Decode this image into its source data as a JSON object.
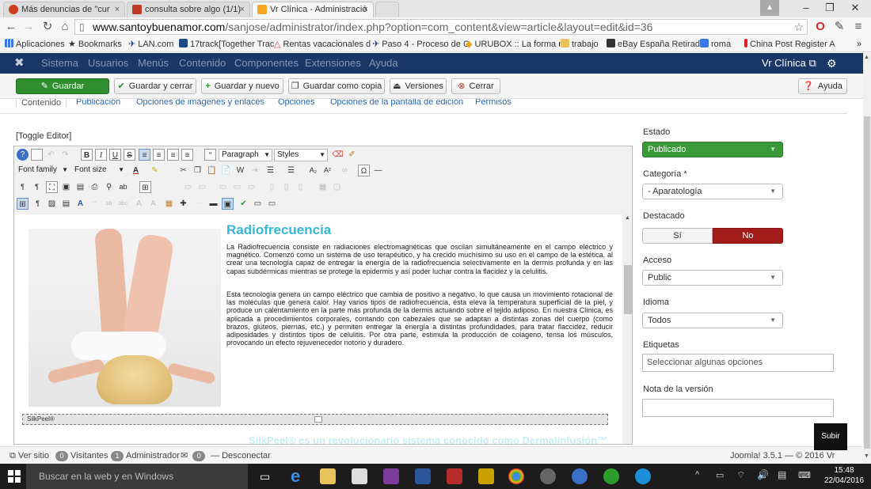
{
  "browser": {
    "tabs": [
      {
        "label": "Más denuncias de \"cur",
        "active": false
      },
      {
        "label": "consulta sobre algo (1/1)",
        "active": false
      },
      {
        "label": "Vr Clínica - Administració",
        "active": true
      }
    ],
    "close_glyph": "×",
    "url_domain": "www.santoybuenamor.com",
    "url_path": "/sanjose/administrator/index.php?option=com_content&view=article&layout=edit&id=36",
    "bookmarks": [
      "Aplicaciones",
      "Bookmarks",
      "LAN.com",
      "17track[Together Trac",
      "Rentas vacacionales d",
      "Paso 4 - Proceso de C",
      "URUBOX :: La forma m",
      "trabajo",
      "eBay España Retirada",
      "roma",
      "China Post Register A"
    ],
    "bookmarks_more": "»"
  },
  "joomla": {
    "menu": [
      "Sistema",
      "Usuarios",
      "Menús",
      "Contenido",
      "Componentes",
      "Extensiones",
      "Ayuda"
    ],
    "site_link": "Vr Clínica",
    "toolbar": {
      "guardar": "Guardar",
      "guardar_cerrar": "Guardar y cerrar",
      "guardar_nuevo": "Guardar y nuevo",
      "guardar_copia": "Guardar como copia",
      "versiones": "Versiones",
      "cerrar": "Cerrar",
      "ayuda": "Ayuda"
    },
    "tabs": [
      "Contenido",
      "Publicación",
      "Opciones de imágenes y enlaces",
      "Opciones",
      "Opciones de la pantalla de edición",
      "Permisos"
    ]
  },
  "editor": {
    "toggle": "[Toggle Editor]",
    "format_select": "Paragraph",
    "styles_select": "Styles",
    "font_family": "Font family",
    "font_size": "Font size",
    "article_title": "Radiofrecuencia",
    "paragraph1": "La Radiofrecuencia consiste en radiaciones electromagnéticas que oscilan simultáneamente en el campo eléctrico y magnético. Comenzó como un sistema de uso terapéutico, y ha crecido muchísimo su uso en el campo de la estética, al crear una tecnología capaz de entregar la energía de la radiofrecuencia selectivamente en la dermis profunda y en las capas subdérmicas mientras se protege la epidermis y así poder luchar contra la flacidez y la celulitis.",
    "paragraph2": "Esta tecnología genera un campo eléctrico que cambia de positivo a negativo, lo que causa un movimiento rotacional de las moléculas que genera calor. Hay varios tipos de radiofrecuencia, ésta eleva la temperatura superficial de la piel, y produce un calentamiento en la parte más profunda de la dermis actuando sobre el tejido adiposo. En nuestra Clínica, es aplicada a procedimientos corporales, contando con cabezales que se adaptan a distintas zonas del cuerpo (como brazos, glúteos, piernas, etc.) y permiten entregar la energía a distintas profundidades, para tratar flaccidez, reducir adiposidades y distintos tipos de celulitis. Por otra parte, estimula la producción de colágeno, tensa los músculos, provocando un efecto rejuvenecedor notorio y duradero.",
    "silkpeel_label": "SilkPeel®",
    "ghost_text": "SilkPeel® es un revolucionario sistema conocido como Dermalinfusión™"
  },
  "sidebar": {
    "estado_label": "Estado",
    "estado_value": "Publicado",
    "categoria_label": "Categoría *",
    "categoria_value": "- Aparatología",
    "destacado_label": "Destacado",
    "destacado_si": "Sí",
    "destacado_no": "No",
    "acceso_label": "Acceso",
    "acceso_value": "Public",
    "idioma_label": "Idioma",
    "idioma_value": "Todos",
    "etiquetas_label": "Etiquetas",
    "etiquetas_placeholder": "Seleccionar algunas opciones",
    "nota_label": "Nota de la versión",
    "nota_value": ""
  },
  "status": {
    "ver_sitio": "Ver sitio",
    "visitantes_count": "0",
    "visitantes": "Visitantes",
    "admin_count": "1",
    "admin": "Administrador",
    "msg_count": "0",
    "desconectar": "Desconectar",
    "version": "Joomla! 3.5.1 — © 2016 Vr Clínica",
    "subir": "Subir"
  },
  "taskbar": {
    "search_placeholder": "Buscar en la web y en Windows",
    "time": "15:48",
    "date": "22/04/2016"
  },
  "colors": {
    "joomla_nav": "#1a3867",
    "save_green": "#2f8f2f",
    "published_green": "#3a9a3a",
    "no_red": "#a31c1c",
    "title_cyan": "#35b8d3"
  }
}
